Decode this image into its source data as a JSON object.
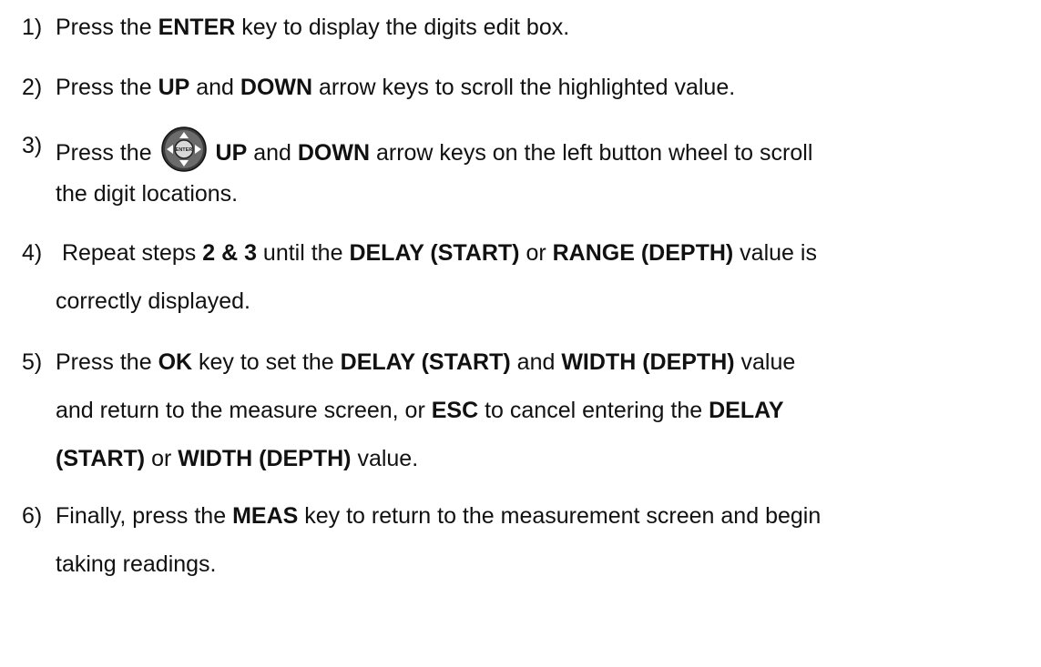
{
  "steps": [
    {
      "number": "1)",
      "lines": [
        [
          {
            "t": "Press the ",
            "b": false
          },
          {
            "t": "ENTER",
            "b": true
          },
          {
            "t": " key to display the digits edit box.",
            "b": false
          }
        ]
      ]
    },
    {
      "number": "2)",
      "lines": [
        [
          {
            "t": "Press the ",
            "b": false
          },
          {
            "t": "UP",
            "b": true
          },
          {
            "t": " and ",
            "b": false
          },
          {
            "t": "DOWN",
            "b": true
          },
          {
            "t": " arrow keys to scroll the highlighted value.",
            "b": false
          }
        ]
      ]
    },
    {
      "number": "3)",
      "lines": [
        [
          {
            "t": "Press the ",
            "b": false
          },
          {
            "icon": "button-wheel-icon"
          },
          {
            "t": " UP",
            "b": true
          },
          {
            "t": " and ",
            "b": false
          },
          {
            "t": "DOWN",
            "b": true
          },
          {
            "t": " arrow keys on the left button wheel to scroll",
            "b": false
          }
        ],
        [
          {
            "t": "the digit locations.",
            "b": false
          }
        ]
      ]
    },
    {
      "number": "4)",
      "lines": [
        [
          {
            "t": " Repeat steps ",
            "b": false
          },
          {
            "t": "2 & 3",
            "b": true
          },
          {
            "t": " until the ",
            "b": false
          },
          {
            "t": "DELAY (START)",
            "b": true
          },
          {
            "t": " or ",
            "b": false
          },
          {
            "t": "RANGE (DEPTH)",
            "b": true
          },
          {
            "t": " value is",
            "b": false
          }
        ],
        [
          {
            "t": "correctly displayed.",
            "b": false
          }
        ]
      ]
    },
    {
      "number": "5)",
      "lines": [
        [
          {
            "t": "Press the ",
            "b": false
          },
          {
            "t": "OK",
            "b": true
          },
          {
            "t": " key to set the ",
            "b": false
          },
          {
            "t": "DELAY (START)",
            "b": true
          },
          {
            "t": " and ",
            "b": false
          },
          {
            "t": "WIDTH (DEPTH)",
            "b": true
          },
          {
            "t": " value",
            "b": false
          }
        ],
        [
          {
            "t": "and return to the measure screen, or ",
            "b": false
          },
          {
            "t": "ESC",
            "b": true
          },
          {
            "t": " to cancel entering the ",
            "b": false
          },
          {
            "t": "DELAY",
            "b": true
          }
        ],
        [
          {
            "t": "(START)",
            "b": true
          },
          {
            "t": " or ",
            "b": false
          },
          {
            "t": "WIDTH (DEPTH)",
            "b": true
          },
          {
            "t": " value.",
            "b": false
          }
        ]
      ]
    },
    {
      "number": "6)",
      "lines": [
        [
          {
            "t": "Finally, press the ",
            "b": false
          },
          {
            "t": "MEAS",
            "b": true
          },
          {
            "t": " key to return to the measurement screen and begin",
            "b": false
          }
        ],
        [
          {
            "t": "taking readings.",
            "b": false
          }
        ]
      ]
    }
  ],
  "wheel_center_label": "ENTER"
}
